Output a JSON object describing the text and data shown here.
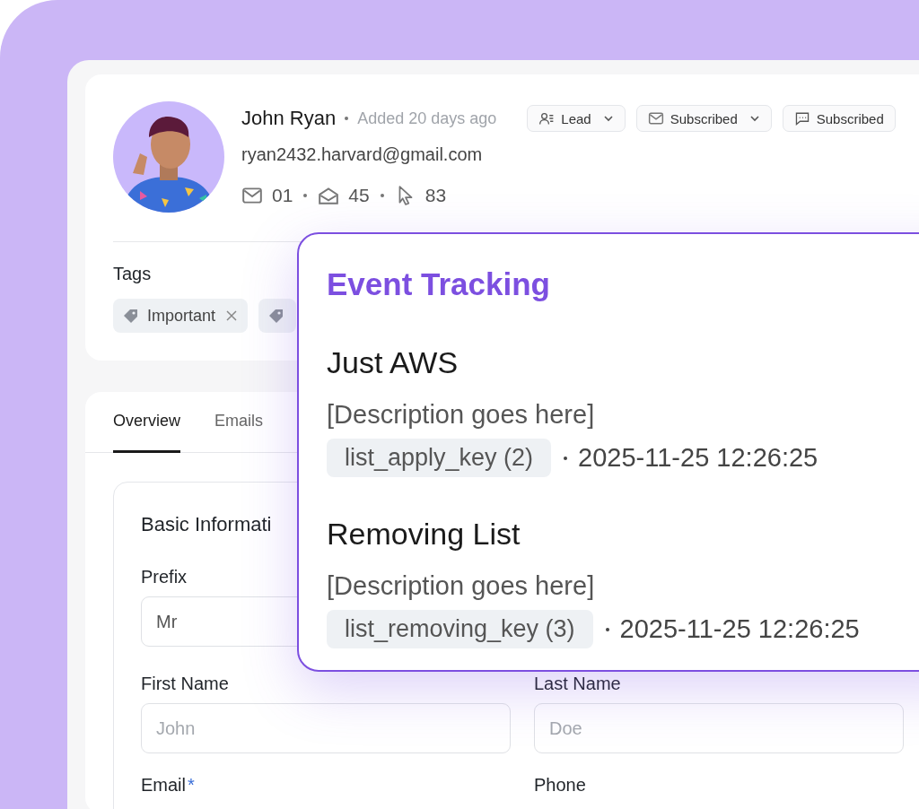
{
  "profile": {
    "name": "John Ryan",
    "added": "Added 20 days ago",
    "email": "ryan2432.harvard@gmail.com",
    "stats": [
      {
        "kind": "sent",
        "value": "01"
      },
      {
        "kind": "opened",
        "value": "45"
      },
      {
        "kind": "clicked",
        "value": "83"
      }
    ],
    "badges": [
      {
        "kind": "person",
        "label": "Lead",
        "dropdown": true
      },
      {
        "kind": "mail",
        "label": "Subscribed",
        "dropdown": true
      },
      {
        "kind": "chat",
        "label": "Subscribed",
        "dropdown": false
      }
    ]
  },
  "tags_section": {
    "title": "Tags",
    "tags": [
      {
        "kind": "full",
        "label": "Important",
        "removable": true
      },
      {
        "kind": "cut"
      }
    ]
  },
  "tabs": [
    {
      "label": "Overview",
      "selected": true
    },
    {
      "label": "Emails",
      "selected": false
    }
  ],
  "form": {
    "title": "Basic Informati",
    "fields": [
      {
        "label": "Prefix",
        "value": "Mr"
      },
      {
        "label": "First Name",
        "placeholder": "John"
      },
      {
        "label": "Last Name",
        "placeholder": "Doe"
      },
      {
        "label": "Email",
        "required_mark": "*"
      },
      {
        "label": "Phone"
      }
    ]
  },
  "popup": {
    "title": "Event Tracking",
    "events": [
      {
        "name": "Just AWS",
        "description": "[Description goes here]",
        "key": "list_apply_key (2)",
        "time": "2025-11-25 12:26:25"
      },
      {
        "name": "Removing List",
        "description": "[Description goes here]",
        "key": "list_removing_key (3)",
        "time": "2025-11-25 12:26:25"
      }
    ]
  }
}
